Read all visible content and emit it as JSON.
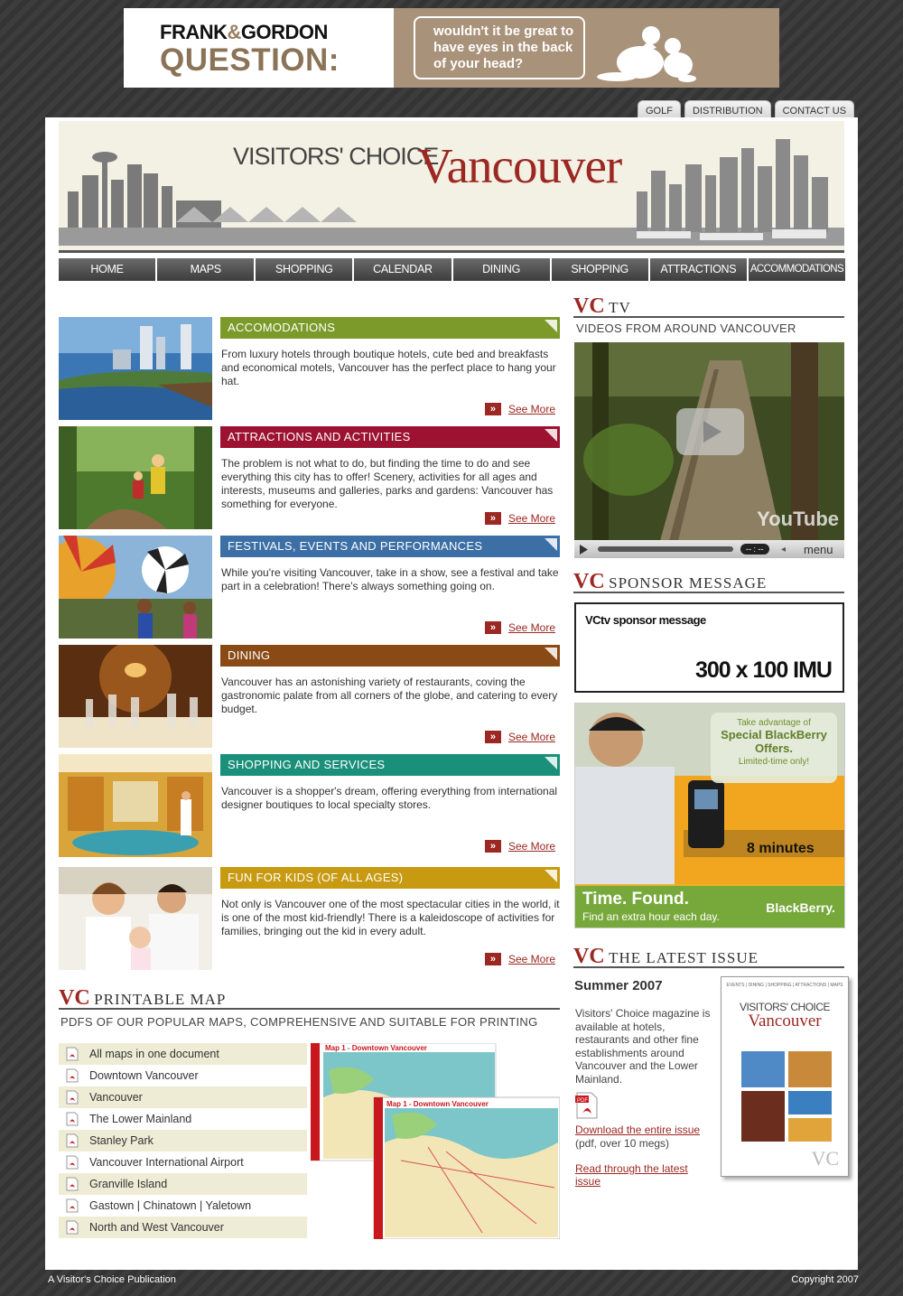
{
  "top_ad": {
    "brand_left": "FRANK",
    "brand_amp": "&",
    "brand_right": "GORDON",
    "question": "QUESTION:",
    "bubble_text": "wouldn't it be great to have eyes in the back of your head?"
  },
  "top_tabs": [
    "GOLF",
    "DISTRIBUTION",
    "CONTACT US"
  ],
  "header": {
    "title_small": "VISITORS' CHOICE",
    "title_big": "Vancouver"
  },
  "nav": [
    "HOME",
    "MAPS",
    "SHOPPING",
    "CALENDAR",
    "DINING",
    "SHOPPING",
    "ATTRACTIONS",
    "ACCOMMODATIONS"
  ],
  "sections": [
    {
      "title": "ACCOMODATIONS",
      "color": "#7c9a2a",
      "text": "From luxury hotels through boutique hotels, cute bed and breakfasts and economical motels, Vancouver has the perfect place to hang your hat.",
      "more": "See More"
    },
    {
      "title": "ATTRACTIONS AND ACTIVITIES",
      "color": "#9c1230",
      "text": "The problem is not what to do, but finding the time to do and see everything this city has to offer! Scenery, activities for all ages and interests, museums and galleries, parks and gardens: Vancouver has something for everyone.",
      "more": "See More"
    },
    {
      "title": "FESTIVALS, EVENTS AND PERFORMANCES",
      "color": "#3b6fa5",
      "text": "While you're visiting Vancouver, take in a show, see a festival and take part in a celebration! There's always something going on.",
      "more": "See More"
    },
    {
      "title": "DINING",
      "color": "#8a4a16",
      "text": "Vancouver has an astonishing variety of restaurants, coving the gastronomic palate from all corners of the globe, and catering to every budget.",
      "more": "See More"
    },
    {
      "title": "SHOPPING AND SERVICES",
      "color": "#1a8f7a",
      "text": "Vancouver is a shopper's dream, offering everything from international designer boutiques to local specialty stores.",
      "more": "See More"
    },
    {
      "title": "FUN FOR KIDS (OF ALL AGES)",
      "color": "#c89a12",
      "text": "Not only is Vancouver one of the most spectacular cities in the world, it is one of the most kid-friendly! There is a kaleidoscope of activities for families, bringing out the kid in every adult.",
      "more": "See More"
    }
  ],
  "vc_tv": {
    "vc": "VC",
    "label": "TV",
    "subtitle": "VIDEOS FROM AROUND VANCOUVER",
    "youtube": "YouTube",
    "menu": "menu",
    "time": "-- : --"
  },
  "sponsor": {
    "vc": "VC",
    "label": "SPONSOR MESSAGE",
    "box_title": "VCtv sponsor message",
    "box_size": "300 x 100 IMU"
  },
  "bb_ad": {
    "line1": "Take advantage of",
    "line2": "Special BlackBerry",
    "line3": "Offers.",
    "line4": "Limited-time only!",
    "minutes": "8 minutes",
    "time_found": "Time. Found.",
    "sub": "Find an extra hour each day.",
    "brand": "BlackBerry."
  },
  "latest_issue": {
    "vc": "VC",
    "label": "THE LATEST ISSUE",
    "title": "Summer 2007",
    "text": "Visitors' Choice magazine is available at hotels, restaurants and other fine establishments around Vancouver and the Lower Mainland.",
    "download": "Download the entire issue",
    "size": "(pdf, over 10 megs)",
    "read": "Read through the latest issue",
    "cover_topline": "EVENTS | DINING | SHOPPING | ATTRACTIONS | MAPS",
    "cover_title_small": "VISITORS' CHOICE",
    "cover_title_big": "Vancouver",
    "cover_mark": "VC",
    "pdf_label": "PDF"
  },
  "printable_map": {
    "vc": "VC",
    "label": "PRINTABLE MAP",
    "subtitle": "PDFS OF OUR POPULAR MAPS, COMPREHENSIVE AND SUITABLE FOR PRINTING",
    "items": [
      "All maps in one document",
      "Downtown Vancouver",
      "Vancouver",
      "The Lower Mainland",
      "Stanley Park",
      "Vancouver International Airport",
      "Granville Island",
      "Gastown | Chinatown | Yaletown",
      "North and West Vancouver"
    ],
    "map_title": "Map 1 - Downtown Vancouver"
  },
  "footer": {
    "left": "A Visitor's Choice Publication",
    "right": "Copyright 2007"
  }
}
